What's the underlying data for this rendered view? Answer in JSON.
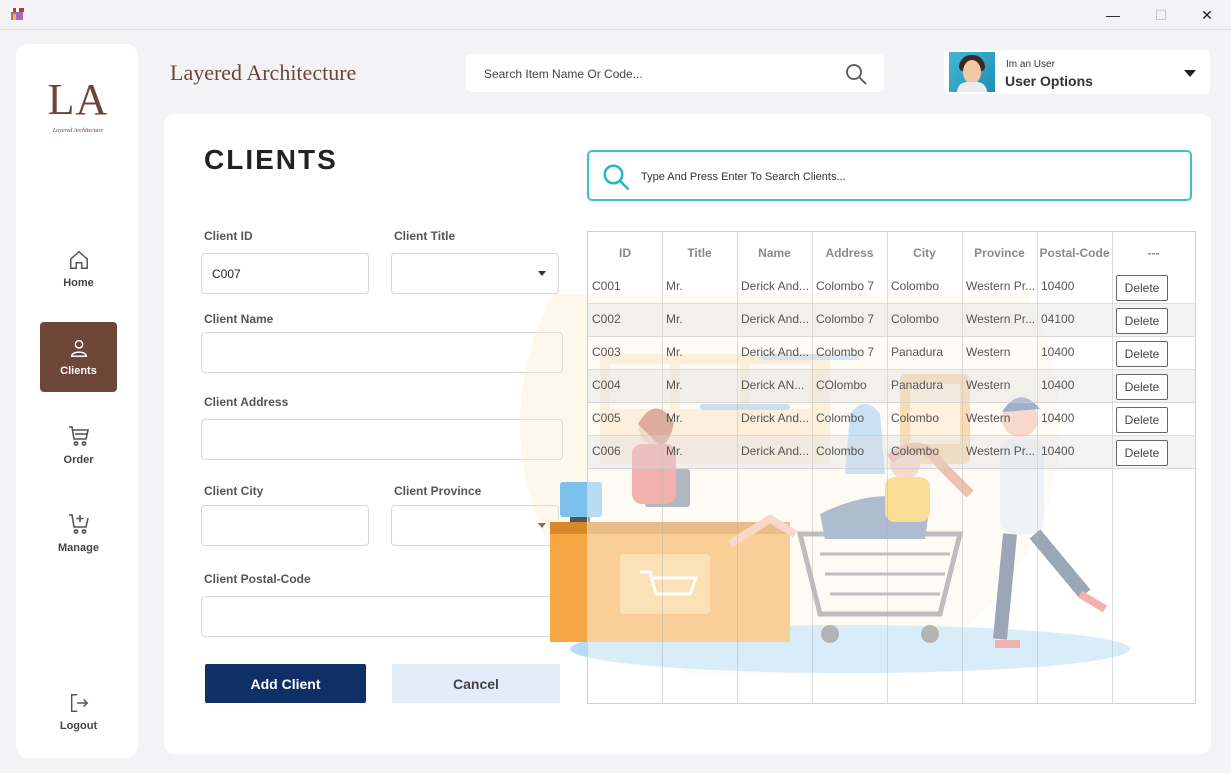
{
  "window": {
    "minimize": "—",
    "maximize": "☐",
    "close": "✕"
  },
  "logo": {
    "mark": "LA",
    "subtitle": "Layered Architecture"
  },
  "sidebar": {
    "items": [
      {
        "label": "Home",
        "icon": "home-icon"
      },
      {
        "label": "Clients",
        "icon": "user-icon",
        "active": true
      },
      {
        "label": "Order",
        "icon": "cart-icon"
      },
      {
        "label": "Manage",
        "icon": "cart-add-icon"
      }
    ],
    "logout": "Logout"
  },
  "header": {
    "brand": "Layered Architecture",
    "search_placeholder": "Search Item Name Or Code...",
    "user_sub": "Im an User",
    "user_title": "User Options"
  },
  "page": {
    "title": "CLIENTS"
  },
  "form": {
    "client_id_label": "Client ID",
    "client_id_value": "C007",
    "client_title_label": "Client Title",
    "client_title_value": "",
    "client_name_label": "Client Name",
    "client_address_label": "Client Address",
    "client_city_label": "Client City",
    "client_province_label": "Client Province",
    "client_postal_label": "Client Postal-Code",
    "add_button": "Add Client",
    "cancel_button": "Cancel"
  },
  "client_search": {
    "placeholder": "Type  And Press Enter To Search Clients..."
  },
  "table": {
    "headers": [
      "ID",
      "Title",
      "Name",
      "Address",
      "City",
      "Province",
      "Postal-Code",
      "---"
    ],
    "delete_label": "Delete",
    "rows": [
      [
        "C001",
        "Mr.",
        "Derick And...",
        "Colombo 7",
        "Colombo",
        "Western Pr...",
        "10400"
      ],
      [
        "C002",
        "Mr.",
        "Derick And...",
        "Colombo 7",
        "Colombo",
        "Western Pr...",
        "04100"
      ],
      [
        "C003",
        "Mr.",
        "Derick And...",
        "Colombo 7",
        "Panadura",
        "Western",
        "10400"
      ],
      [
        "C004",
        "Mr.",
        "Derick AN...",
        "COlombo",
        "Panadura",
        "Western",
        "10400"
      ],
      [
        "C005",
        "Mr.",
        "Derick And...",
        "Colombo",
        "Colombo",
        "Western",
        "10400"
      ],
      [
        "C006",
        "Mr.",
        "Derick And...",
        "Colombo",
        "Colombo",
        "Western Pr...",
        "10400"
      ]
    ]
  },
  "colors": {
    "brand": "#6e4637",
    "primary": "#0f3066",
    "accent": "#39c2c9"
  }
}
